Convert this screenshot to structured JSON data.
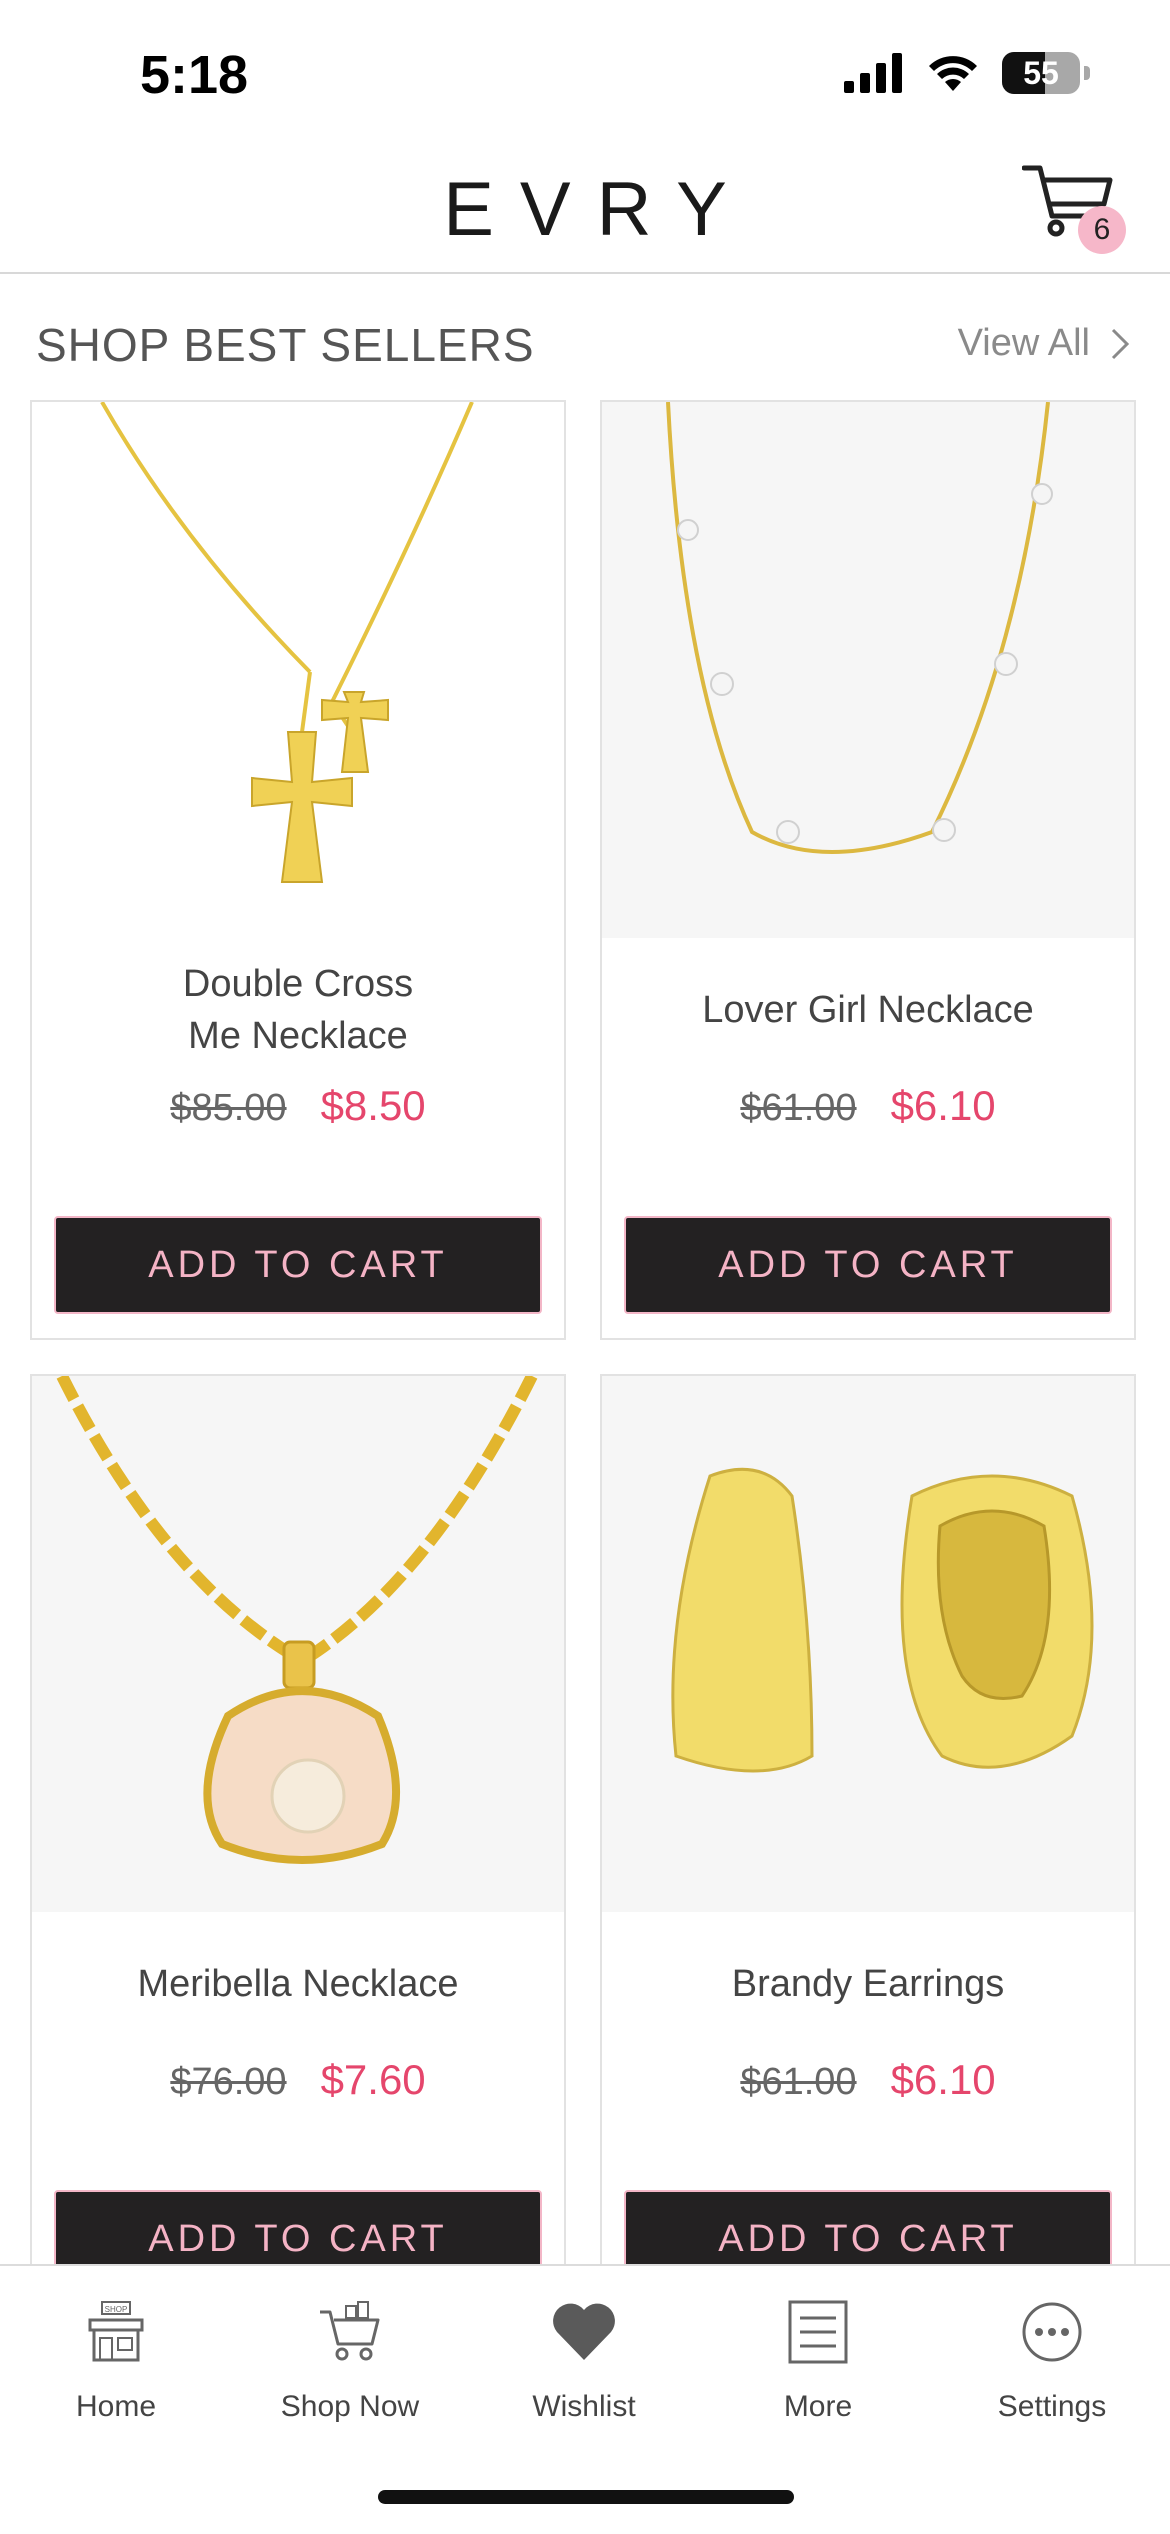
{
  "status_bar": {
    "time": "5:18",
    "battery": "55",
    "battery_level": 0.55
  },
  "header": {
    "logo": "EVRY",
    "cart_count": "6"
  },
  "section": {
    "title": "SHOP BEST SELLERS",
    "view_all": "View All"
  },
  "products": [
    {
      "name_line1": "Double Cross",
      "name_line2": "Me Necklace",
      "old_price": "$85.00",
      "new_price": "$8.50",
      "cta": "ADD TO CART"
    },
    {
      "name_line1": "Lover Girl Necklace",
      "old_price": "$61.00",
      "new_price": "$6.10",
      "cta": "ADD TO CART"
    },
    {
      "name_line1": "Meribella Necklace",
      "old_price": "$76.00",
      "new_price": "$7.60",
      "cta": "ADD TO CART"
    },
    {
      "name_line1": "Brandy Earrings",
      "old_price": "$61.00",
      "new_price": "$6.10",
      "cta": "ADD TO CART"
    }
  ],
  "tabbar": {
    "items": [
      {
        "label": "Home",
        "icon": "shop-storefront-icon"
      },
      {
        "label": "Shop Now",
        "icon": "shopping-cart-icon"
      },
      {
        "label": "Wishlist",
        "icon": "heart-icon"
      },
      {
        "label": "More",
        "icon": "list-icon"
      },
      {
        "label": "Settings",
        "icon": "more-dots-icon"
      }
    ]
  },
  "colors": {
    "accent_pink": "#e5466c",
    "button_bg": "#232122",
    "button_text": "#f4b3c5",
    "badge_bg": "#f6b7c9"
  }
}
